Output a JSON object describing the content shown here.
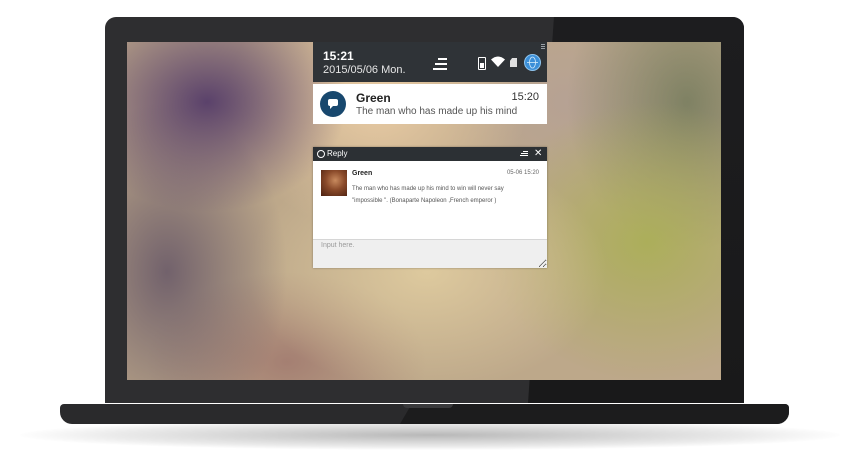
{
  "colors": {
    "status_bar_bg": "#2f3337",
    "notification_icon_bg": "#18486e",
    "accent_blue": "#3b8fd8",
    "laptop_body": "#2e2e30"
  },
  "status_panel": {
    "time": "15:21",
    "date": "2015/05/06 Mon.",
    "icons": [
      "menu-icon",
      "battery-icon",
      "wifi-icon",
      "sd-card-icon",
      "globe-icon"
    ]
  },
  "notification": {
    "sender": "Green",
    "time": "15:20",
    "message": "The man who has made up his mind",
    "icon": "chat-bubble-icon"
  },
  "reply_window": {
    "title": "Reply",
    "sender": "Green",
    "timestamp": "05-06 15:20",
    "message": "The man who has made up his mind to win will never say \"impossible \". (Bonaparte Napoleon ,French emperor )",
    "input_placeholder": "Input here.",
    "input_value": "",
    "close_symbol": "✕"
  }
}
